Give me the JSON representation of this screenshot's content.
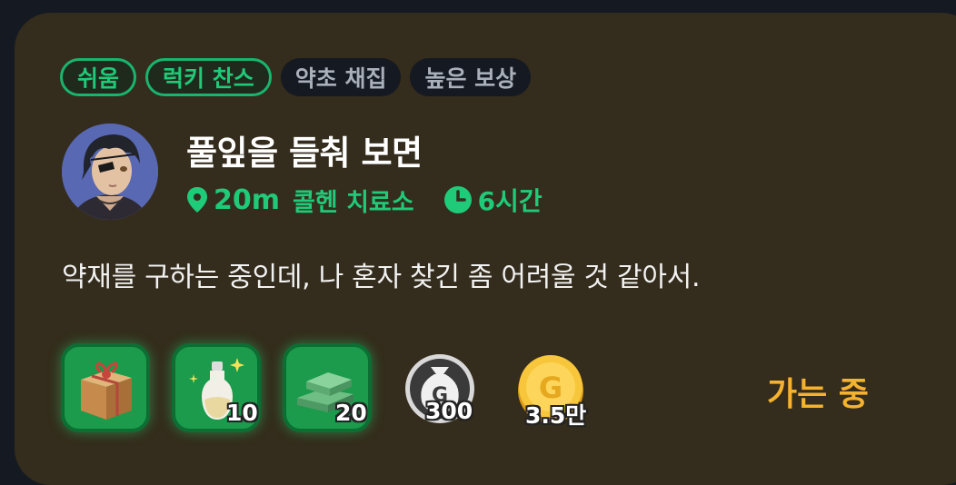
{
  "tags": [
    {
      "label": "쉬움",
      "style": "green"
    },
    {
      "label": "럭키 찬스",
      "style": "green"
    },
    {
      "label": "약초 채집",
      "style": "dark"
    },
    {
      "label": "높은 보상",
      "style": "dark"
    }
  ],
  "quest": {
    "title": "풀잎을 들춰 보면",
    "distance": "20m",
    "location": "콜헨 치료소",
    "duration": "6시간",
    "description": "약재를 구하는 중인데, 나 혼자 찾긴 좀 어려울 것 같아서."
  },
  "rewards": [
    {
      "icon": "gift-box-icon",
      "quantity": ""
    },
    {
      "icon": "potion-bottle-icon",
      "quantity": "10"
    },
    {
      "icon": "herb-bundle-icon",
      "quantity": "20"
    },
    {
      "icon": "money-bag-icon",
      "quantity": "300"
    },
    {
      "icon": "gold-coin-icon",
      "quantity": "3.5만"
    }
  ],
  "status": "가는 중",
  "colors": {
    "card_bg": "#342c1c",
    "accent_green": "#1fca78",
    "status_orange": "#f4b22e",
    "tag_dark_bg": "#141922"
  }
}
